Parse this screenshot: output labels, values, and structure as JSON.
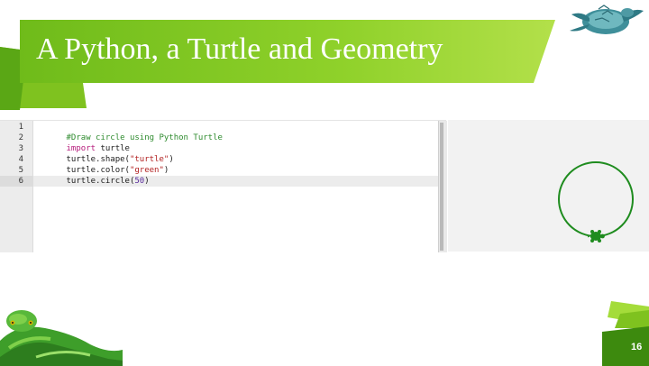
{
  "slide": {
    "title": "A Python, a Turtle and Geometry",
    "page_number": "16",
    "accent_colors": [
      "#8fd12a",
      "#5aa715",
      "#3d8a0e"
    ]
  },
  "editor": {
    "line_numbers": [
      "1",
      "2",
      "3",
      "4",
      "5",
      "6"
    ],
    "code": {
      "line1": "#Draw circle using Python Turtle",
      "line2_kw": "import",
      "line2_rest": " turtle",
      "line3_pre": "turtle.shape(",
      "line3_str": "\"turtle\"",
      "line3_post": ")",
      "line4_pre": "turtle.color(",
      "line4_str": "\"green\"",
      "line4_post": ")",
      "line5_pre": "turtle.circle(",
      "line5_num": "50",
      "line5_post": ")"
    },
    "active_line": 6
  },
  "canvas": {
    "shape": "circle",
    "turtle_color": "#1f8c1f",
    "radius": 50
  },
  "images": {
    "turtle": "sea-turtle-photo",
    "python": "green-python-snake-photo"
  }
}
